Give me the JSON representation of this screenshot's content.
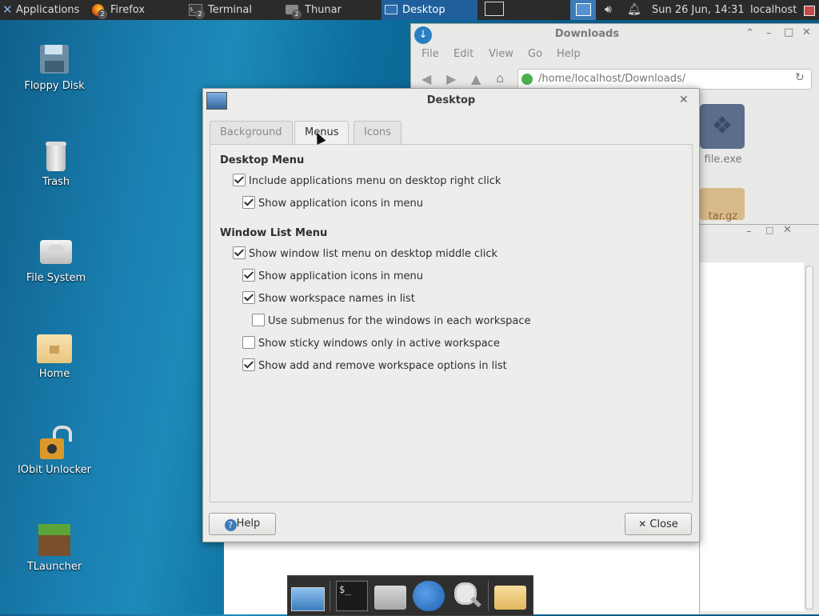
{
  "top_panel": {
    "applications_label": "Applications",
    "tasks": [
      {
        "label": "Firefox",
        "badge": "2"
      },
      {
        "label": "Terminal",
        "badge": "2"
      },
      {
        "label": "Thunar",
        "badge": "2"
      },
      {
        "label": "Desktop",
        "badge": ""
      }
    ],
    "clock": "Sun 26 Jun, 14:31",
    "user": "localhost"
  },
  "desktop_icons": [
    {
      "label": "Floppy Disk",
      "icon": "floppy-icon"
    },
    {
      "label": "Trash",
      "icon": "trash-icon"
    },
    {
      "label": "File System",
      "icon": "drive-icon"
    },
    {
      "label": "Home",
      "icon": "home-folder-icon"
    },
    {
      "label": "IObit Unlocker",
      "icon": "unlock-icon"
    },
    {
      "label": "TLauncher",
      "icon": "grass-block-icon"
    }
  ],
  "thunar": {
    "title": "Downloads",
    "menu": [
      "File",
      "Edit",
      "View",
      "Go",
      "Help"
    ],
    "path": "/home/localhost/Downloads/",
    "files": [
      {
        "label": "file.exe"
      },
      {
        "label": "tar.gz"
      }
    ]
  },
  "dialog": {
    "title": "Desktop",
    "tabs": [
      "Background",
      "Menus",
      "Icons"
    ],
    "active_tab": "Menus",
    "desktop_menu_heading": "Desktop Menu",
    "desktop_menu_options": [
      {
        "label": "Include applications menu on desktop right click",
        "checked": true
      },
      {
        "label": "Show application icons in menu",
        "checked": true
      }
    ],
    "window_list_heading": "Window List Menu",
    "window_list_options": [
      {
        "label": "Show window list menu on desktop middle click",
        "checked": true
      },
      {
        "label": "Show application icons in menu",
        "checked": true
      },
      {
        "label": "Show workspace names in list",
        "checked": true
      },
      {
        "label": "Use submenus for the windows in each workspace",
        "checked": false
      },
      {
        "label": "Show sticky windows only in active workspace",
        "checked": false
      },
      {
        "label": "Show add and remove workspace options in list",
        "checked": true
      }
    ],
    "help_label": "Help",
    "close_label": "Close"
  },
  "colors": {
    "accent": "#2a7fc1",
    "panel": "#2b2b2b",
    "desktop": "#1380b3"
  }
}
